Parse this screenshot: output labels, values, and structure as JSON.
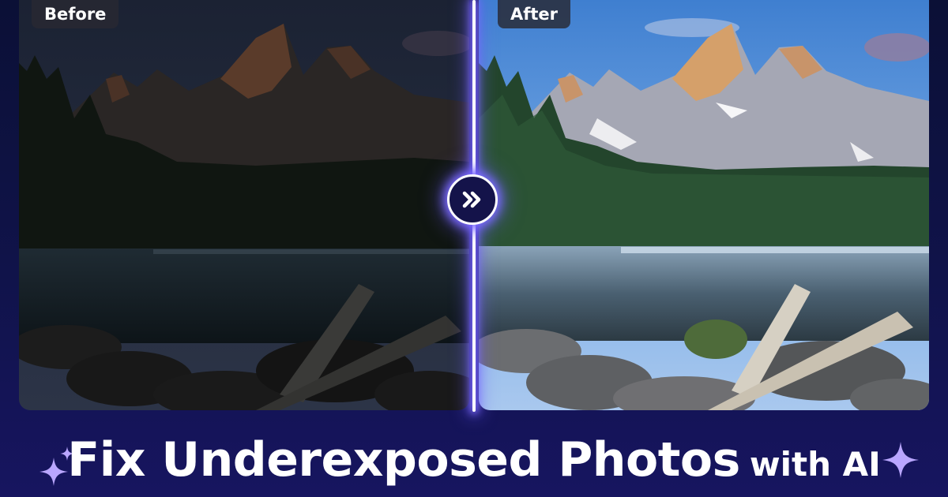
{
  "comparison": {
    "before_label": "Before",
    "after_label": "After",
    "handle_icon": "double-chevron-right-icon"
  },
  "headline": {
    "main": "Fix Underexposed Photos",
    "sub": "with AI"
  },
  "icons": {
    "left_sparkles": "sparkle-icon",
    "right_sparkle": "sparkle-icon"
  },
  "colors": {
    "background": "#0b1036",
    "accent_glow": "#7c6bff",
    "sparkle": "#b9a6ff",
    "text": "#ffffff"
  }
}
